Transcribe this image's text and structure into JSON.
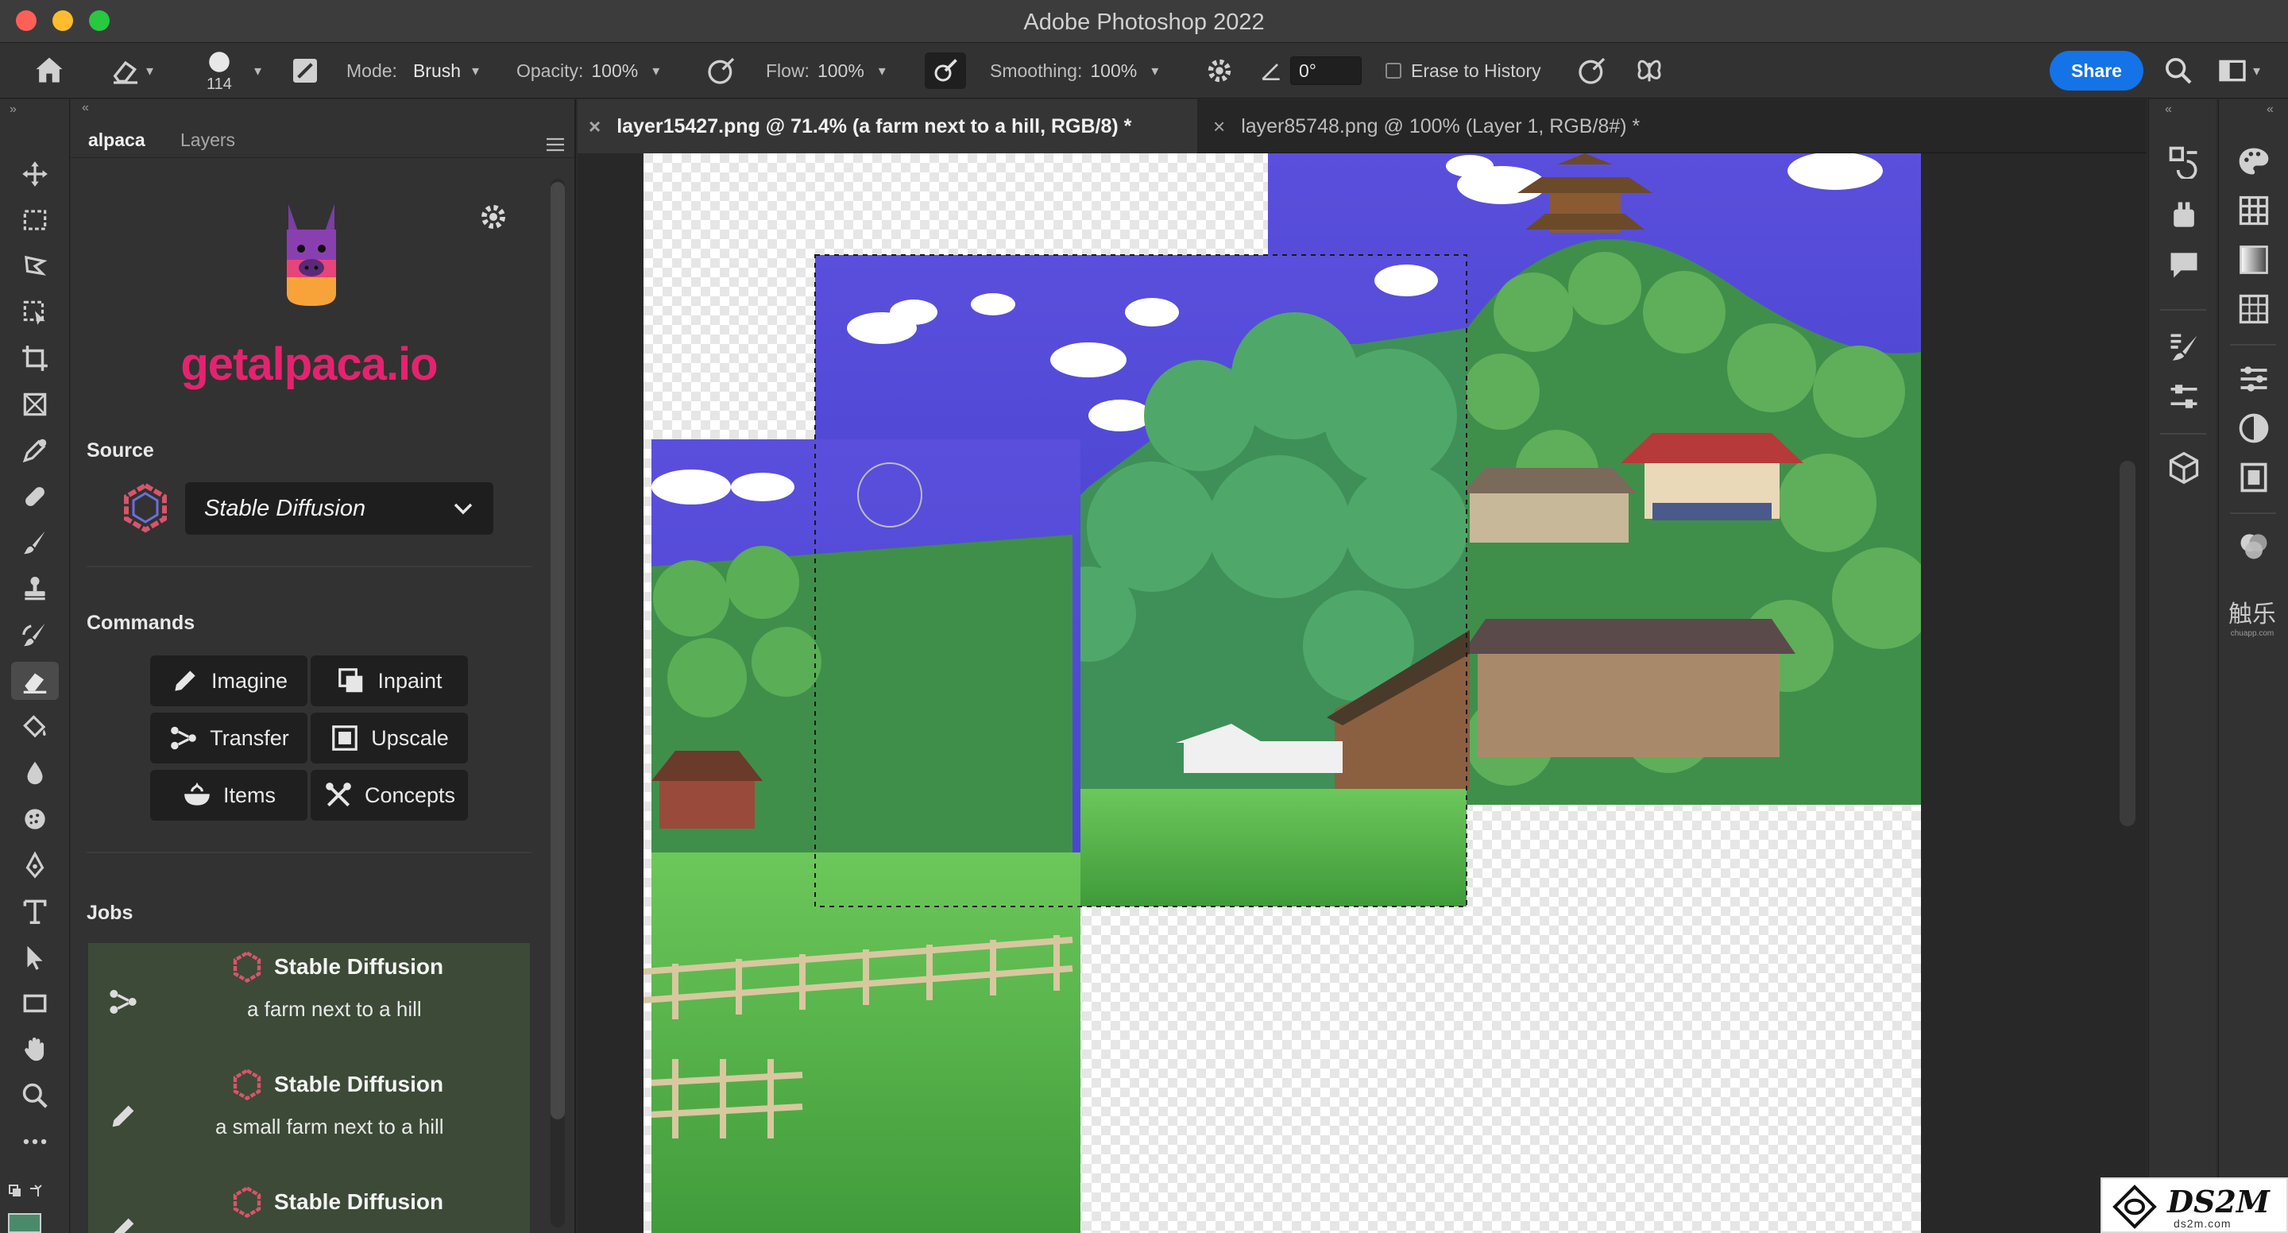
{
  "window": {
    "title": "Adobe Photoshop 2022"
  },
  "options_bar": {
    "brush_size": "114",
    "mode_label": "Mode:",
    "mode_value": "Brush",
    "opacity_label": "Opacity:",
    "opacity_value": "100%",
    "flow_label": "Flow:",
    "flow_value": "100%",
    "smoothing_label": "Smoothing:",
    "smoothing_value": "100%",
    "angle_value": "0°",
    "erase_to_history_label": "Erase to History",
    "share_label": "Share"
  },
  "panel": {
    "tabs": [
      "alpaca",
      "Layers"
    ],
    "logo_text": "getalpaca.io",
    "source_heading": "Source",
    "source_value": "Stable Diffusion",
    "commands_heading": "Commands",
    "commands": [
      "Imagine",
      "Inpaint",
      "Transfer",
      "Upscale",
      "Items",
      "Concepts"
    ],
    "jobs_heading": "Jobs",
    "jobs": [
      {
        "title": "Stable Diffusion",
        "prompt": "a farm next to a hill",
        "icon": "transfer-icon"
      },
      {
        "title": "Stable Diffusion",
        "prompt": "a small farm next to a hill",
        "icon": "imagine-icon"
      },
      {
        "title": "Stable Diffusion",
        "prompt": "",
        "icon": "imagine-icon"
      }
    ]
  },
  "document_tabs": [
    {
      "label": "layer15427.png @ 71.4% (a farm next to a hill, RGB/8) *",
      "active": true
    },
    {
      "label": "layer85748.png @ 100% (Layer 1, RGB/8#) *",
      "active": false
    }
  ],
  "watermark": {
    "brand": "DS2M",
    "domain": "ds2m.com",
    "mark_glyphs": "触乐",
    "mark_sub": "chuapp.com"
  },
  "colors": {
    "accent": "#1473e6",
    "logo_pink": "#e4236f",
    "job_bg": "#3c4a37",
    "sky_purple": "#5a4fdc"
  }
}
